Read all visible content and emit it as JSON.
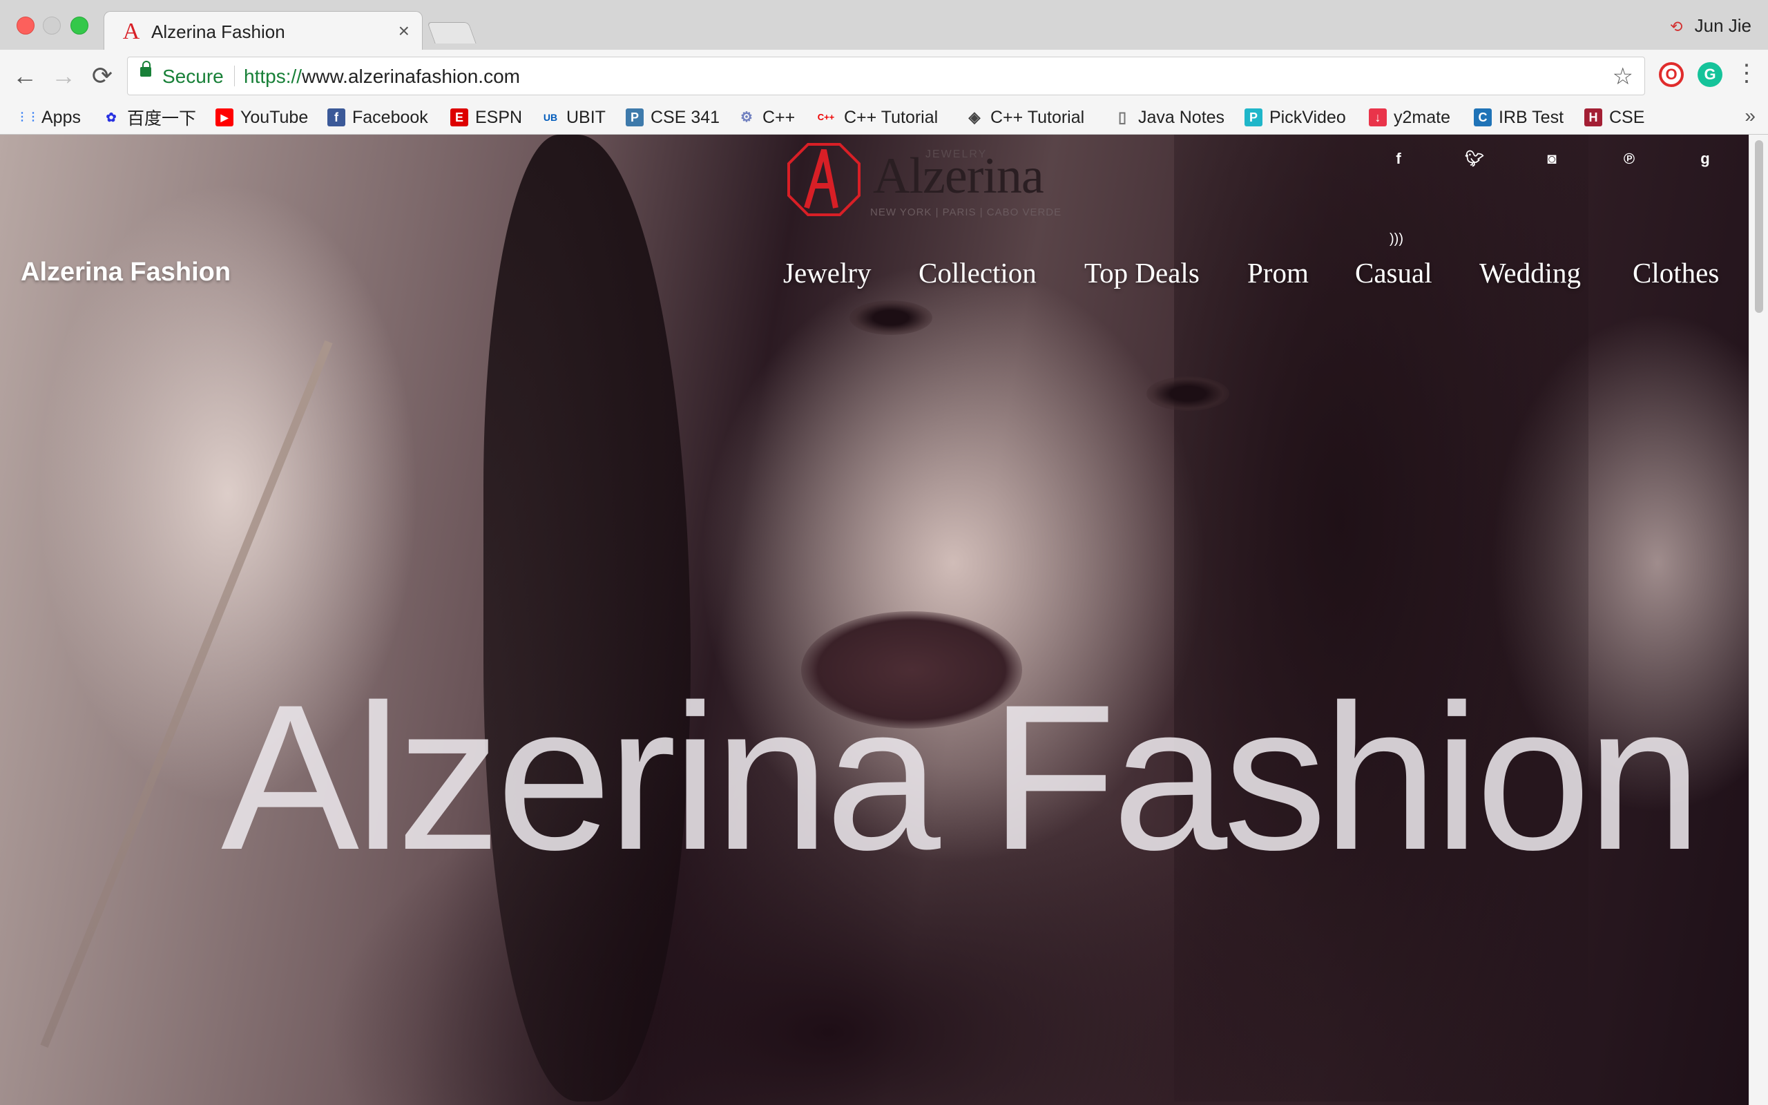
{
  "browser": {
    "tab": {
      "title": "Alzerina Fashion",
      "close_glyph": "×",
      "favicon": "A"
    },
    "profile_name": "Jun Jie",
    "profile_icon": "⟲",
    "nav": {
      "back": "←",
      "forward": "→",
      "reload": "⟳"
    },
    "address": {
      "secure_label": "Secure",
      "scheme": "https://",
      "host": "www.alzerinafashion.com"
    },
    "star_glyph": "☆",
    "menu_glyph": "⋮",
    "extensions": [
      {
        "name": "opera-vpn-icon",
        "glyph": "O"
      },
      {
        "name": "grammarly-icon",
        "glyph": "G"
      }
    ],
    "bookmarks_more": "»",
    "bookmarks": [
      {
        "label": "Apps",
        "icon": "apps-grid-icon",
        "glyph": "⋮⋮",
        "color": "#4285f4"
      },
      {
        "label": "百度一下",
        "icon": "baidu-paw-icon",
        "glyph": "✿",
        "color": "#2932e1"
      },
      {
        "label": "YouTube",
        "icon": "youtube-icon",
        "glyph": "▶",
        "color": "#ff0000"
      },
      {
        "label": "Facebook",
        "icon": "facebook-icon",
        "glyph": "f",
        "color": "#3b5998"
      },
      {
        "label": "ESPN",
        "icon": "espn-icon",
        "glyph": "E",
        "color": "#d00"
      },
      {
        "label": "UBIT",
        "icon": "ub-icon",
        "glyph": "UB",
        "color": "#005bbb"
      },
      {
        "label": "CSE 341",
        "icon": "piazza-icon",
        "glyph": "P",
        "color": "#3e7aab"
      },
      {
        "label": "C++",
        "icon": "cpp-icon",
        "glyph": "⚙",
        "color": "#6f7fbf"
      },
      {
        "label": "C++ Tutorial",
        "icon": "cpp-tutorial-icon",
        "glyph": "C++",
        "color": "#e00"
      },
      {
        "label": "C++ Tutorial",
        "icon": "diamond-icon",
        "glyph": "◈",
        "color": "#444"
      },
      {
        "label": "Java Notes",
        "icon": "document-icon",
        "glyph": "▯",
        "color": "#777"
      },
      {
        "label": "PickVideo",
        "icon": "pickvideo-icon",
        "glyph": "P",
        "color": "#1fb6c9"
      },
      {
        "label": "y2mate",
        "icon": "download-icon",
        "glyph": "↓",
        "color": "#e9344a"
      },
      {
        "label": "IRB Test",
        "icon": "citi-icon",
        "glyph": "C",
        "color": "#1f73b7"
      },
      {
        "label": "CSE",
        "icon": "h-icon",
        "glyph": "H",
        "color": "#a31f34"
      }
    ]
  },
  "site": {
    "brand": "Alzerina Fashion",
    "logo": {
      "word": "Alzerina",
      "small": "JEWELRY",
      "tagline": "NEW YORK | PARIS | CABO VERDE"
    },
    "social": [
      {
        "name": "facebook-icon",
        "glyph": "f"
      },
      {
        "name": "twitter-icon",
        "glyph": "🐦︎"
      },
      {
        "name": "instagram-icon",
        "glyph": "◙"
      },
      {
        "name": "pinterest-icon",
        "glyph": "℗"
      },
      {
        "name": "google-plus-icon",
        "glyph": "g"
      }
    ],
    "rss_glyph": ")))",
    "menu": [
      "Jewelry",
      "Collection",
      "Top Deals",
      "Prom",
      "Casual",
      "Wedding",
      "Clothes"
    ],
    "hero_title": "Alzerina Fashion"
  },
  "colors": {
    "secure_green": "#188038",
    "logo_red": "#d81f26"
  }
}
